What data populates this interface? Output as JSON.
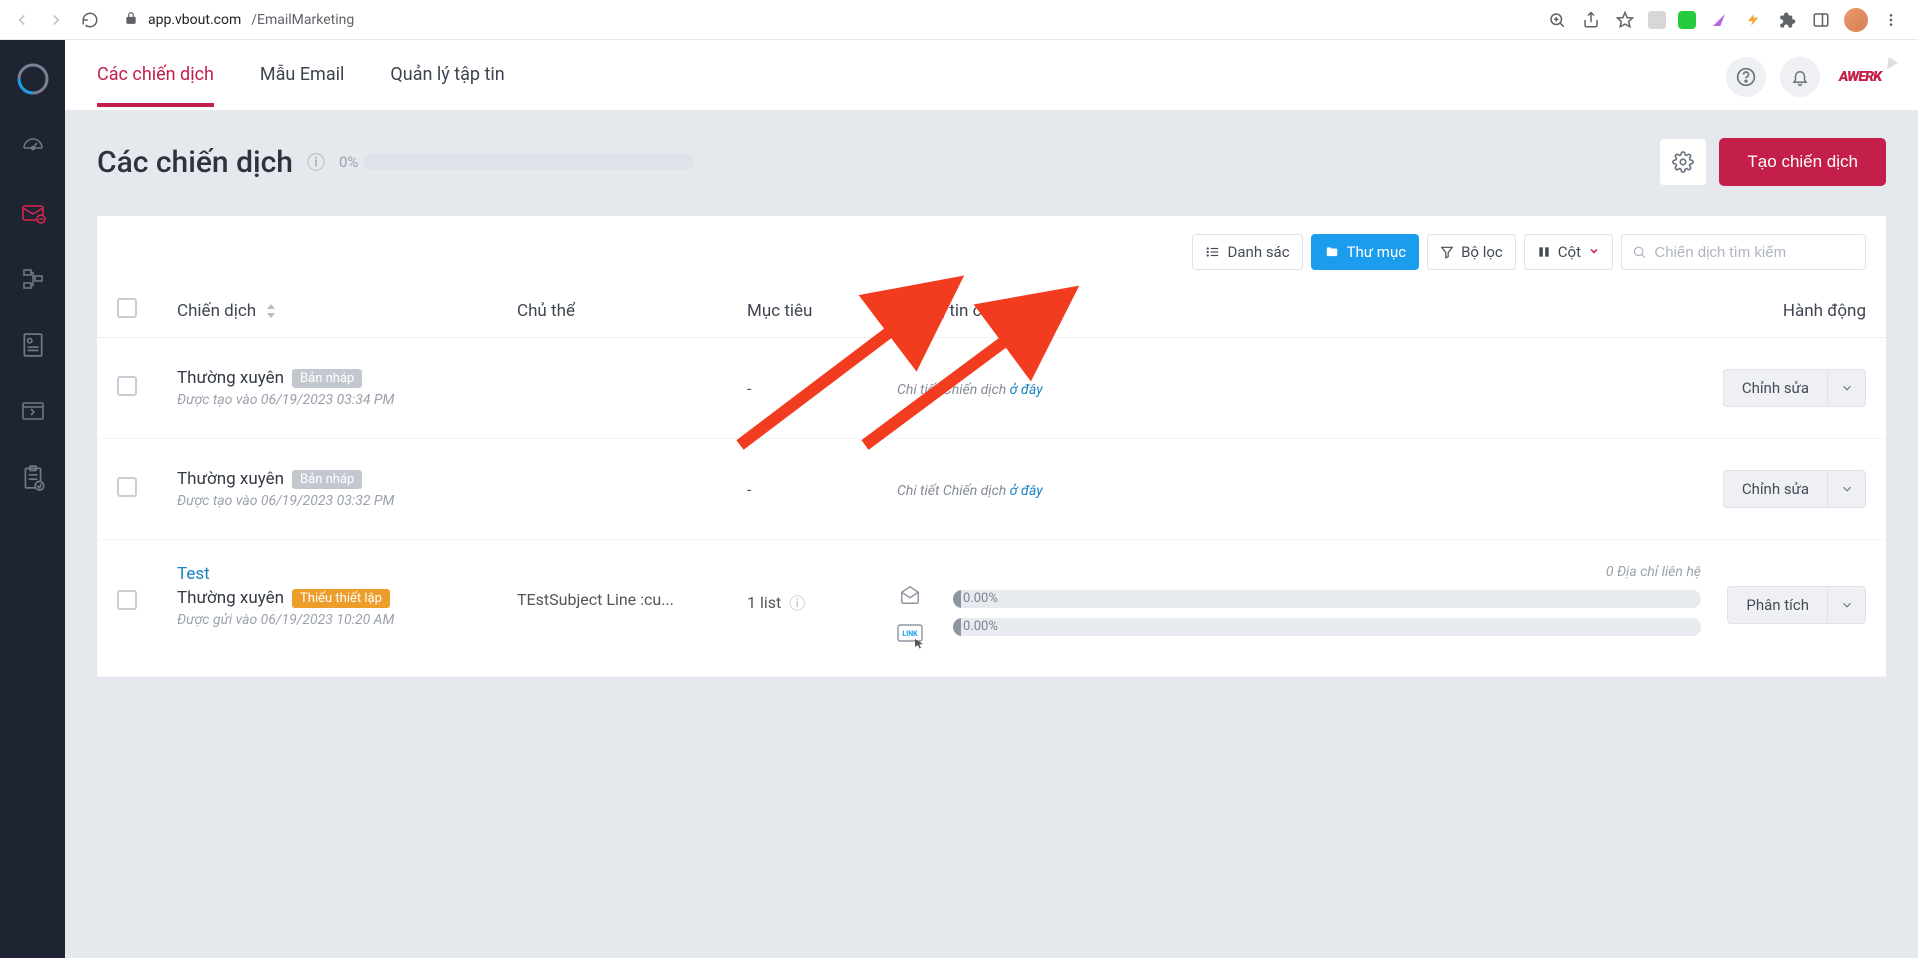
{
  "browser": {
    "url_host": "app.vbout.com",
    "url_path": "/EmailMarketing"
  },
  "tabs": {
    "campaigns": "Các chiến dịch",
    "templates": "Mẫu Email",
    "files": "Quản lý tập tin"
  },
  "page": {
    "title": "Các chiến dịch",
    "progress_label": "0%"
  },
  "actions": {
    "create": "Tạo chiến dịch"
  },
  "toolbar": {
    "list": "Danh sác",
    "folders": "Thư mục",
    "filter": "Bộ lọc",
    "columns": "Cột",
    "search_placeholder": "Chiến dịch tìm kiếm"
  },
  "columns": {
    "campaign": "Chiến dịch",
    "subject": "Chủ thể",
    "target": "Mục tiêu",
    "detail": "Thông tin chi tiết",
    "action": "Hành động"
  },
  "rows": [
    {
      "type": "Thường xuyên",
      "badge": "Bản nháp",
      "badge_class": "grey",
      "sub": "Được tạo vào 06/19/2023 03:34 PM",
      "subject": "",
      "target": "-",
      "detail_text": "Chi tiết Chiến dịch ",
      "detail_link": "ở đây",
      "action": "Chỉnh sửa"
    },
    {
      "type": "Thường xuyên",
      "badge": "Bản nháp",
      "badge_class": "grey",
      "sub": "Được tạo vào 06/19/2023 03:32 PM",
      "subject": "",
      "target": "-",
      "detail_text": "Chi tiết Chiến dịch ",
      "detail_link": "ở đây",
      "action": "Chỉnh sửa"
    },
    {
      "title": "Test",
      "type": "Thường xuyên",
      "badge": "Thiếu thiết lập",
      "badge_class": "orange",
      "sub": "Được gửi vào 06/19/2023 10:20 AM",
      "subject": "TEstSubject Line :cu...",
      "target": "1 list",
      "meta": "0 Địa chỉ liên hệ",
      "bar1": "0.00%",
      "bar2": "0.00%",
      "action": "Phân tích"
    }
  ],
  "brand_text": "AWERK"
}
